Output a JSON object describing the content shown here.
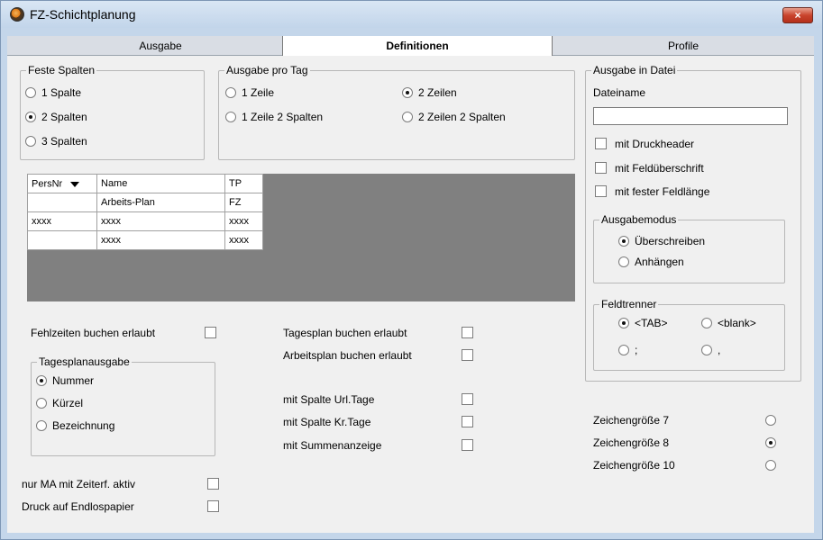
{
  "window": {
    "title": "FZ-Schichtplanung",
    "close_label": "×"
  },
  "tabs": [
    {
      "label": "Ausgabe"
    },
    {
      "label": "Definitionen"
    },
    {
      "label": "Profile"
    }
  ],
  "feste_spalten": {
    "label": "Feste Spalten",
    "options": [
      "1 Spalte",
      "2 Spalten",
      "3 Spalten"
    ],
    "selected": "2 Spalten"
  },
  "ausgabe_pro_tag": {
    "label": "Ausgabe pro Tag",
    "options": [
      "1 Zeile",
      "2 Zeilen",
      "1 Zeile 2 Spalten",
      "2 Zeilen 2 Spalten"
    ],
    "selected": "2 Zeilen"
  },
  "grid": {
    "headers": [
      "PersNr",
      "Name",
      "TP"
    ],
    "rows": [
      [
        "",
        "Arbeits-Plan",
        "FZ"
      ],
      [
        "xxxx",
        "xxxx",
        "xxxx"
      ],
      [
        "",
        "xxxx",
        "xxxx"
      ]
    ]
  },
  "ausgabe_in_datei": {
    "label": "Ausgabe in Datei",
    "dateiname_label": "Dateiname",
    "dateiname_value": "",
    "checkboxes": [
      "mit Druckheader",
      "mit Feldüberschrift",
      "mit fester Feldlänge"
    ]
  },
  "ausgabemodus": {
    "label": "Ausgabemodus",
    "options": [
      "Überschreiben",
      "Anhängen"
    ],
    "selected": "Überschreiben"
  },
  "feldtrenner": {
    "label": "Feldtrenner",
    "options": [
      "<TAB>",
      "<blank>",
      ";",
      ","
    ],
    "selected": "<TAB>"
  },
  "left_checks": {
    "fehlzeiten": "Fehlzeiten buchen erlaubt",
    "nur_ma": "nur MA mit Zeiterf. aktiv",
    "druck": "Druck auf Endlospapier"
  },
  "tagesplanausgabe": {
    "label": "Tagesplanausgabe",
    "options": [
      "Nummer",
      "Kürzel",
      "Bezeichnung"
    ],
    "selected": "Nummer"
  },
  "middle_checks": [
    "Tagesplan buchen erlaubt",
    "Arbeitsplan buchen erlaubt",
    "mit Spalte Url.Tage",
    "mit Spalte Kr.Tage",
    "mit Summenanzeige"
  ],
  "zeichengroesse": {
    "options": [
      "Zeichengröße  7",
      "Zeichengröße  8",
      "Zeichengröße  10"
    ],
    "selected": "Zeichengröße  8"
  }
}
